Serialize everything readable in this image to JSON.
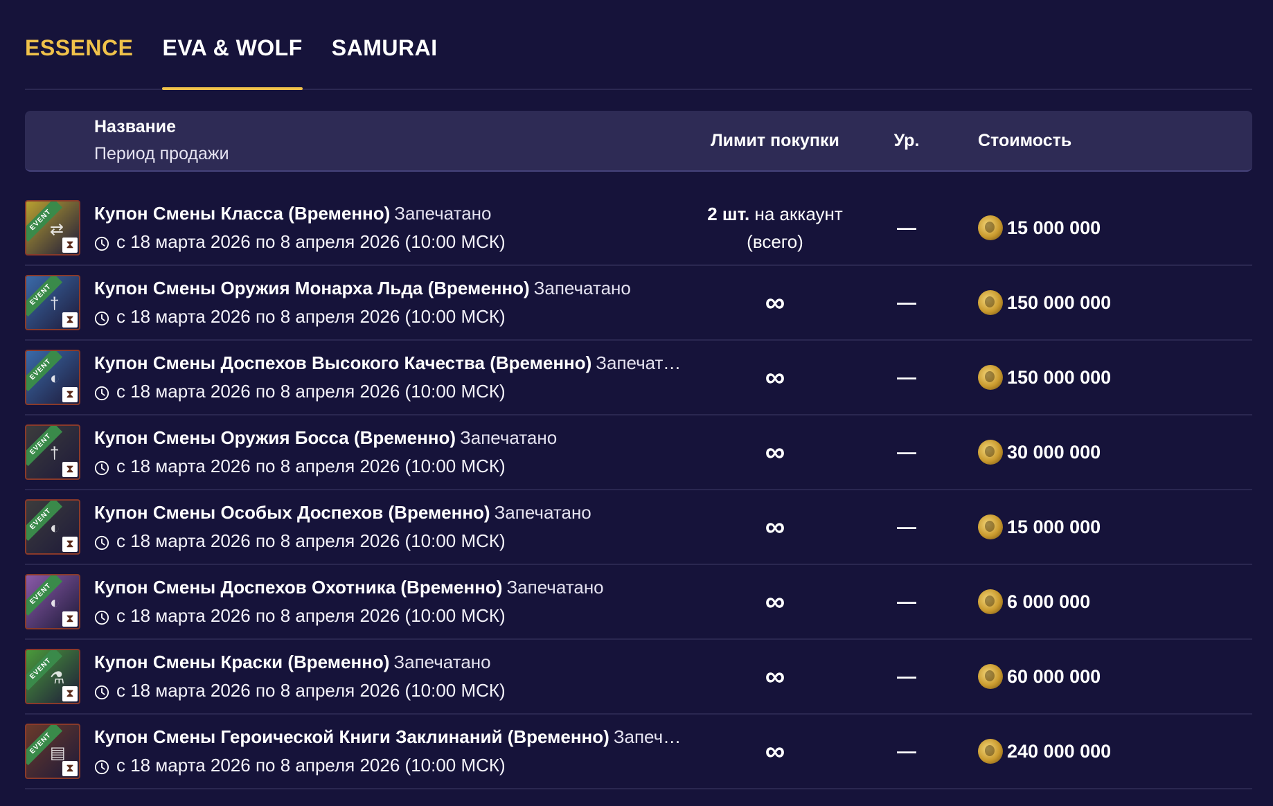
{
  "tabs": [
    {
      "label": "ESSENCE",
      "accent": true,
      "active": false
    },
    {
      "label": "EVA & WOLF",
      "accent": false,
      "active": true
    },
    {
      "label": "SAMURAI",
      "accent": false,
      "active": false
    }
  ],
  "header": {
    "name": "Название",
    "period": "Период продажи",
    "limit": "Лимит покупки",
    "level": "Ур.",
    "cost": "Стоимость"
  },
  "rows": [
    {
      "name": "Купон Смены Класса (Временно)",
      "status": "Запечатано",
      "period": "с 18 марта 2026 по 8 апреля 2026 (10:00 МСК)",
      "limit_bold": "2 шт.",
      "limit_rest": "на аккаунт",
      "limit_sub": "(всего)",
      "level": "—",
      "cost": "15 000 000",
      "icon_color": "#b8a030",
      "icon": "event-coupon-class-icon"
    },
    {
      "name": "Купон Смены Оружия Монарха Льда (Временно)",
      "status": "Запечатано",
      "period": "с 18 марта 2026 по 8 апреля 2026 (10:00 МСК)",
      "limit": "∞",
      "level": "—",
      "cost": "150 000 000",
      "icon_color": "#3a6aa8",
      "icon": "event-coupon-weapon-icon"
    },
    {
      "name": "Купон Смены Доспехов Высокого Качества (Временно)",
      "status": "Запечатано",
      "period": "с 18 марта 2026 по 8 апреля 2026 (10:00 МСК)",
      "limit": "∞",
      "level": "—",
      "cost": "150 000 000",
      "icon_color": "#3a6aa8",
      "icon": "event-coupon-armor-icon"
    },
    {
      "name": "Купон Смены Оружия Босса (Временно)",
      "status": "Запечатано",
      "period": "с 18 марта 2026 по 8 апреля 2026 (10:00 МСК)",
      "limit": "∞",
      "level": "—",
      "cost": "30 000 000",
      "icon_color": "#3c3c3c",
      "icon": "event-coupon-weapon-icon"
    },
    {
      "name": "Купон Смены Особых Доспехов (Временно)",
      "status": "Запечатано",
      "period": "с 18 марта 2026 по 8 апреля 2026 (10:00 МСК)",
      "limit": "∞",
      "level": "—",
      "cost": "15 000 000",
      "icon_color": "#3c3c3c",
      "icon": "event-coupon-armor-icon"
    },
    {
      "name": "Купон Смены Доспехов Охотника (Временно)",
      "status": "Запечатано",
      "period": "с 18 марта 2026 по 8 апреля 2026 (10:00 МСК)",
      "limit": "∞",
      "level": "—",
      "cost": "6 000 000",
      "icon_color": "#8a5aa8",
      "icon": "event-coupon-armor-icon"
    },
    {
      "name": "Купон Смены Краски (Временно)",
      "status": "Запечатано",
      "period": "с 18 марта 2026 по 8 апреля 2026 (10:00 МСК)",
      "limit": "∞",
      "level": "—",
      "cost": "60 000 000",
      "icon_color": "#4a9a3a",
      "icon": "event-coupon-dye-icon"
    },
    {
      "name": "Купон Смены Героической Книги Заклинаний (Временно)",
      "status": "Запечата...",
      "period": "с 18 марта 2026 по 8 апреля 2026 (10:00 МСК)",
      "limit": "∞",
      "level": "—",
      "cost": "240 000 000",
      "icon_color": "#6a3a2a",
      "icon": "event-coupon-spellbook-icon"
    }
  ],
  "colors": {
    "background": "#16133a",
    "header_bg": "#2e2b55",
    "accent": "#f0c24a"
  }
}
